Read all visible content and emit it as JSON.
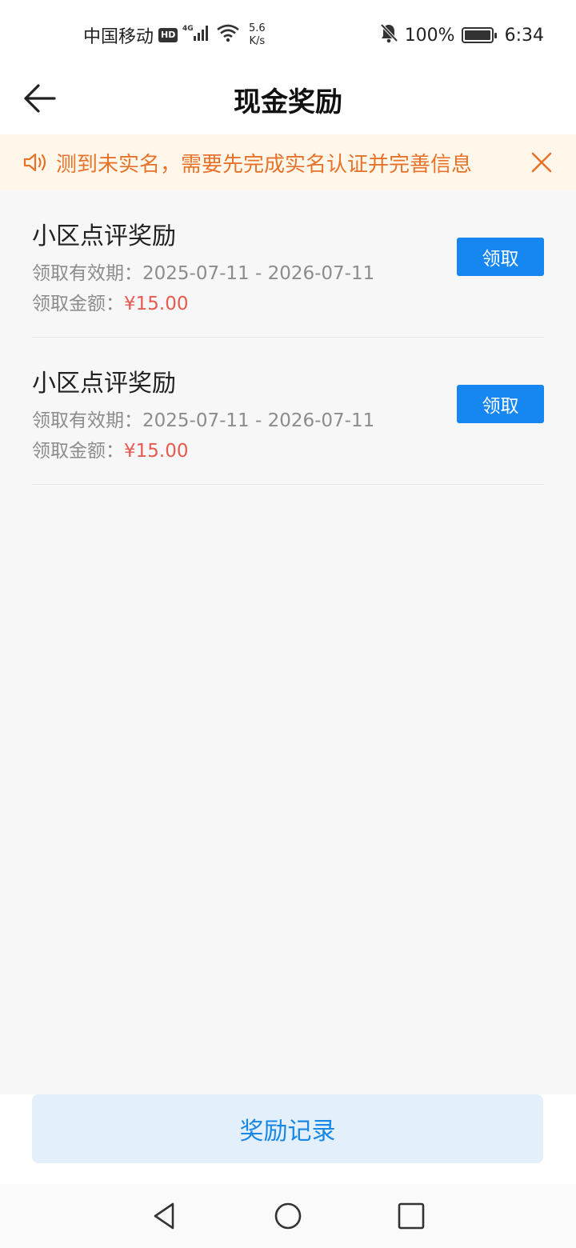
{
  "status_bar": {
    "carrier": "中国移动",
    "hd_badge": "HD",
    "network": "4G",
    "speed_value": "5.6",
    "speed_unit": "K/s",
    "battery": "100%",
    "time": "6:34"
  },
  "header": {
    "title": "现金奖励",
    "back_icon": "arrow-left-icon"
  },
  "notice": {
    "icon": "speaker-icon",
    "text": "测到未实名，需要先完成实名认证并完善信息",
    "close_icon": "close-icon",
    "color": "#e8722a",
    "background": "#fff8ea"
  },
  "rewards": [
    {
      "title": "小区点评奖励",
      "period_label": "领取有效期：",
      "period": "2025-07-11 - 2026-07-11",
      "amount_label": "领取金额：",
      "amount": "¥15.00",
      "button": "领取"
    },
    {
      "title": "小区点评奖励",
      "period_label": "领取有效期：",
      "period": "2025-07-11 - 2026-07-11",
      "amount_label": "领取金额：",
      "amount": "¥15.00",
      "button": "领取"
    }
  ],
  "bottom": {
    "records_button": "奖励记录"
  },
  "colors": {
    "primary": "#1687f0",
    "amount": "#e85a4f",
    "records_bg": "#e3f0fb"
  }
}
